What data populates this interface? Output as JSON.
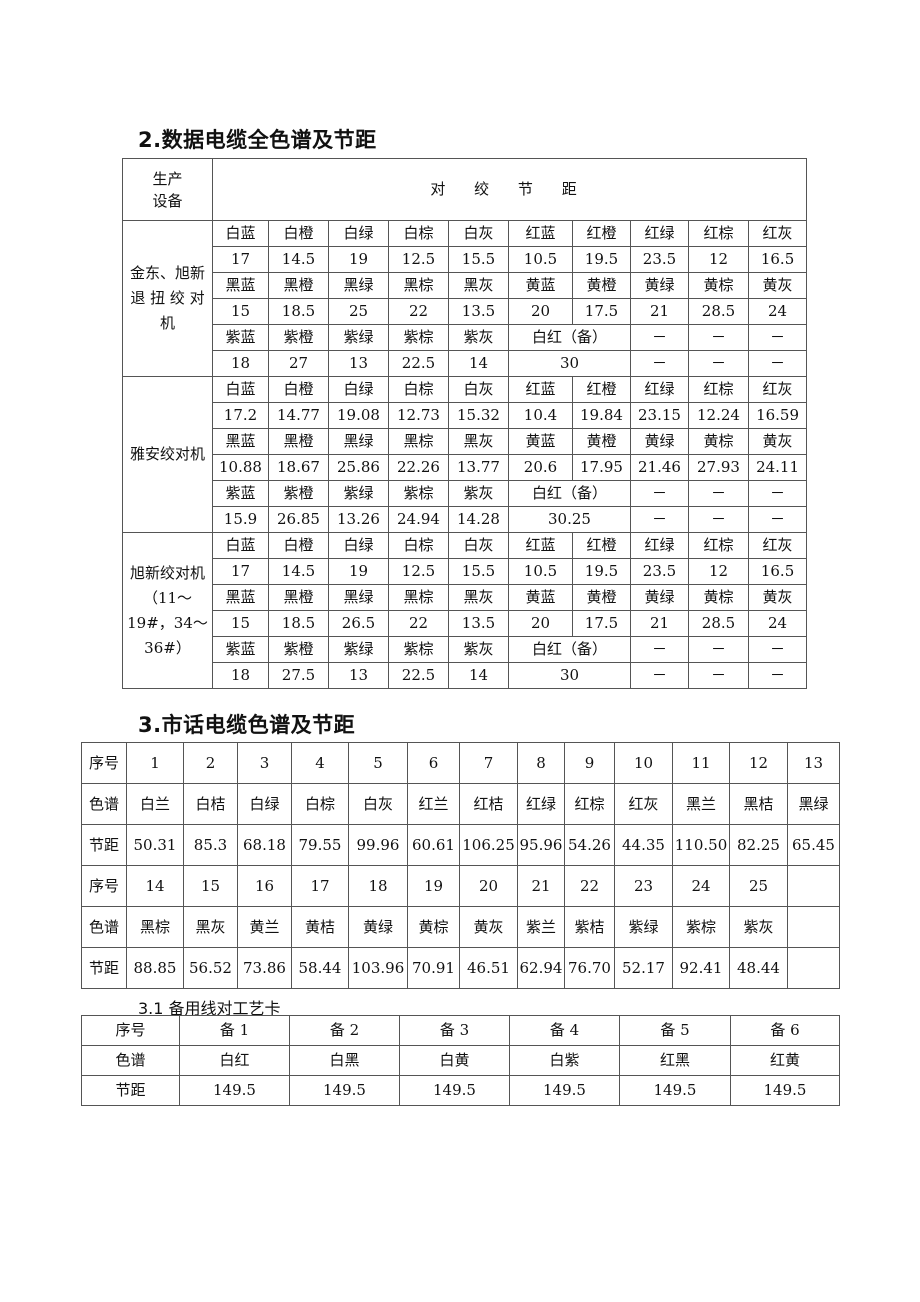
{
  "section2": {
    "title": "2.数据电缆全色谱及节距",
    "header": {
      "device_label": "生产\n设备",
      "pitch_label": "对 绞 节 距"
    },
    "groups": [
      {
        "device": "金东、旭新退 扭 绞 对机",
        "rows": [
          [
            "白蓝",
            "白橙",
            "白绿",
            "白棕",
            "白灰",
            "红蓝",
            "红橙",
            "红绿",
            "红棕",
            "红灰"
          ],
          [
            "17",
            "14.5",
            "19",
            "12.5",
            "15.5",
            "10.5",
            "19.5",
            "23.5",
            "12",
            "16.5"
          ],
          [
            "黑蓝",
            "黑橙",
            "黑绿",
            "黑棕",
            "黑灰",
            "黄蓝",
            "黄橙",
            "黄绿",
            "黄棕",
            "黄灰"
          ],
          [
            "15",
            "18.5",
            "25",
            "22",
            "13.5",
            "20",
            "17.5",
            "21",
            "28.5",
            "24"
          ],
          [
            "紫蓝",
            "紫橙",
            "紫绿",
            "紫棕",
            "紫灰",
            "白红（备）",
            "－",
            "－",
            "－"
          ],
          [
            "18",
            "27",
            "13",
            "22.5",
            "14",
            "30",
            "－",
            "－",
            "－"
          ]
        ]
      },
      {
        "device": "雅安绞对机",
        "rows": [
          [
            "白蓝",
            "白橙",
            "白绿",
            "白棕",
            "白灰",
            "红蓝",
            "红橙",
            "红绿",
            "红棕",
            "红灰"
          ],
          [
            "17.2",
            "14.77",
            "19.08",
            "12.73",
            "15.32",
            "10.4",
            "19.84",
            "23.15",
            "12.24",
            "16.59"
          ],
          [
            "黑蓝",
            "黑橙",
            "黑绿",
            "黑棕",
            "黑灰",
            "黄蓝",
            "黄橙",
            "黄绿",
            "黄棕",
            "黄灰"
          ],
          [
            "10.88",
            "18.67",
            "25.86",
            "22.26",
            "13.77",
            "20.6",
            "17.95",
            "21.46",
            "27.93",
            "24.11"
          ],
          [
            "紫蓝",
            "紫橙",
            "紫绿",
            "紫棕",
            "紫灰",
            "白红（备）",
            "－",
            "－",
            "－"
          ],
          [
            "15.9",
            "26.85",
            "13.26",
            "24.94",
            "14.28",
            "30.25",
            "－",
            "－",
            "－"
          ]
        ]
      },
      {
        "device": "旭新绞对机（11～19#，34～36#）",
        "rows": [
          [
            "白蓝",
            "白橙",
            "白绿",
            "白棕",
            "白灰",
            "红蓝",
            "红橙",
            "红绿",
            "红棕",
            "红灰"
          ],
          [
            "17",
            "14.5",
            "19",
            "12.5",
            "15.5",
            "10.5",
            "19.5",
            "23.5",
            "12",
            "16.5"
          ],
          [
            "黑蓝",
            "黑橙",
            "黑绿",
            "黑棕",
            "黑灰",
            "黄蓝",
            "黄橙",
            "黄绿",
            "黄棕",
            "黄灰"
          ],
          [
            "15",
            "18.5",
            "26.5",
            "22",
            "13.5",
            "20",
            "17.5",
            "21",
            "28.5",
            "24"
          ],
          [
            "紫蓝",
            "紫橙",
            "紫绿",
            "紫棕",
            "紫灰",
            "白红（备）",
            "－",
            "－",
            "－"
          ],
          [
            "18",
            "27.5",
            "13",
            "22.5",
            "14",
            "30",
            "－",
            "－",
            "－"
          ]
        ]
      }
    ]
  },
  "section3": {
    "title": "3.市话电缆色谱及节距",
    "row_labels": {
      "seq": "序号",
      "color": "色谱",
      "pitch": "节距"
    },
    "block1": {
      "seq": [
        "1",
        "2",
        "3",
        "4",
        "5",
        "6",
        "7",
        "8",
        "9",
        "10",
        "11",
        "12",
        "13"
      ],
      "color": [
        "白兰",
        "白桔",
        "白绿",
        "白棕",
        "白灰",
        "红兰",
        "红桔",
        "红绿",
        "红棕",
        "红灰",
        "黑兰",
        "黑桔",
        "黑绿"
      ],
      "pitch": [
        "50.31",
        "85.3",
        "68.18",
        "79.55",
        "99.96",
        "60.61",
        "106.25",
        "95.96",
        "54.26",
        "44.35",
        "110.50",
        "82.25",
        "65.45"
      ]
    },
    "block2": {
      "seq": [
        "14",
        "15",
        "16",
        "17",
        "18",
        "19",
        "20",
        "21",
        "22",
        "23",
        "24",
        "25",
        ""
      ],
      "color": [
        "黑棕",
        "黑灰",
        "黄兰",
        "黄桔",
        "黄绿",
        "黄棕",
        "黄灰",
        "紫兰",
        "紫桔",
        "紫绿",
        "紫棕",
        "紫灰",
        ""
      ],
      "pitch": [
        "88.85",
        "56.52",
        "73.86",
        "58.44",
        "103.96",
        "70.91",
        "46.51",
        "62.94",
        "76.70",
        "52.17",
        "92.41",
        "48.44",
        ""
      ]
    }
  },
  "section31": {
    "title": "3.1 备用线对工艺卡",
    "row_labels": {
      "seq": "序号",
      "color": "色谱",
      "pitch": "节距"
    },
    "seq": [
      "备 1",
      "备 2",
      "备 3",
      "备 4",
      "备 5",
      "备 6"
    ],
    "color": [
      "白红",
      "白黑",
      "白黄",
      "白紫",
      "红黑",
      "红黄"
    ],
    "pitch": [
      "149.5",
      "149.5",
      "149.5",
      "149.5",
      "149.5",
      "149.5"
    ]
  }
}
